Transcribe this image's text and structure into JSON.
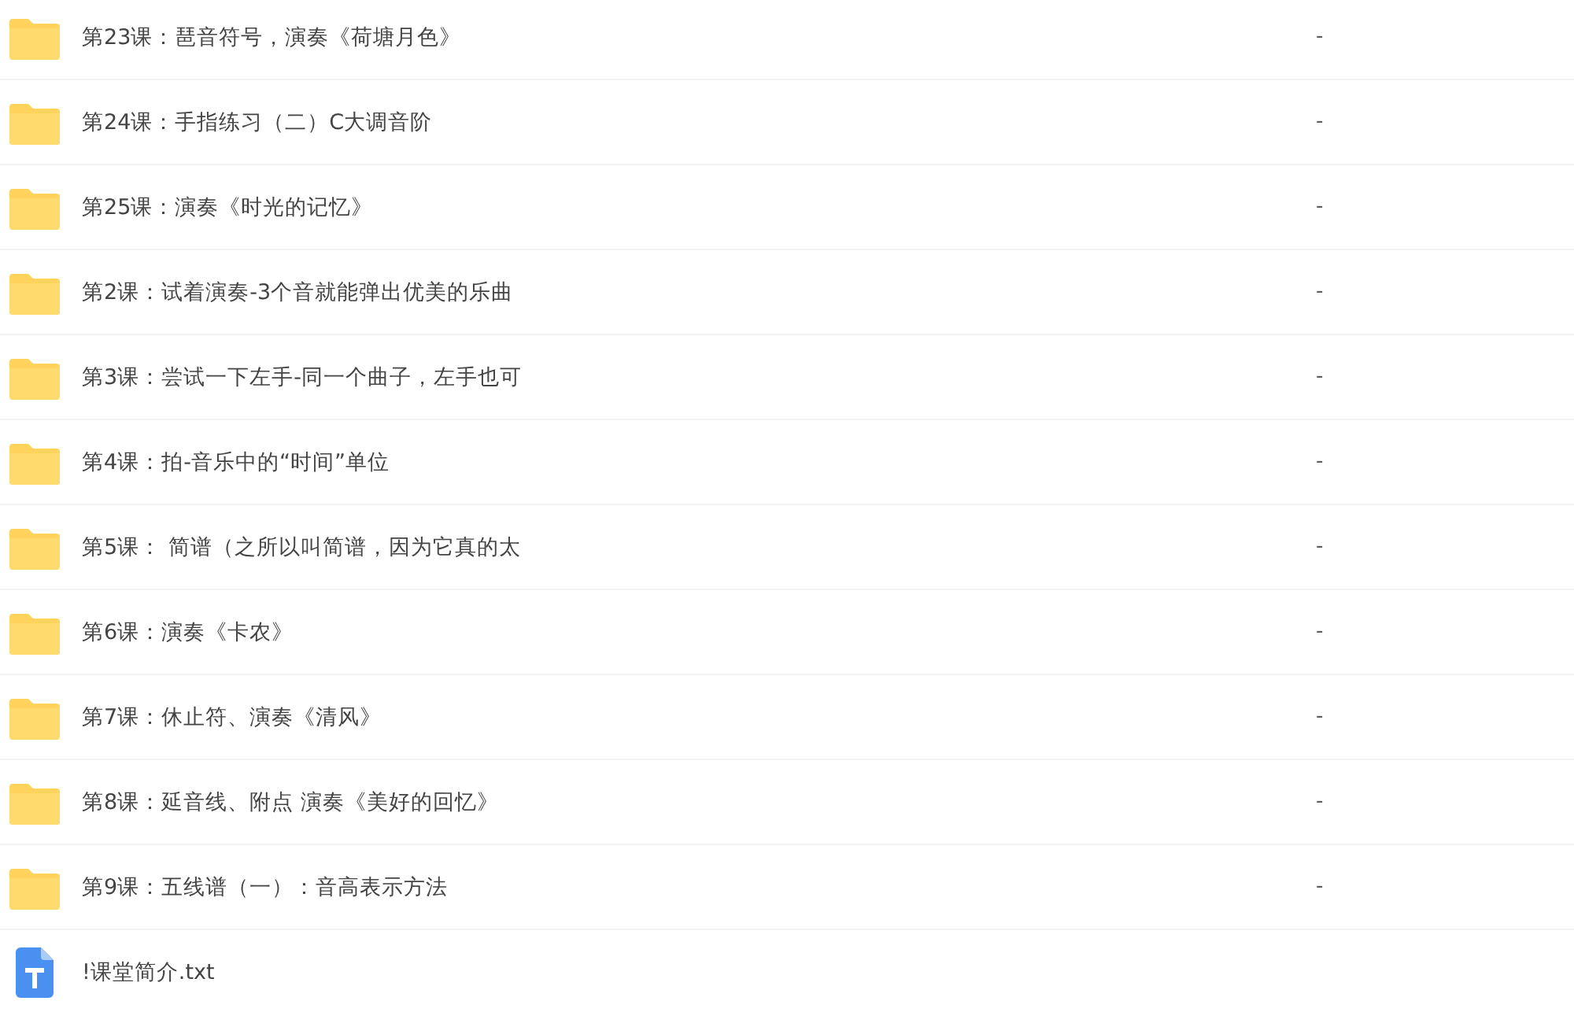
{
  "files": [
    {
      "kind": "folder",
      "name": "第23课：琶音符号，演奏《荷塘月色》",
      "size": "-"
    },
    {
      "kind": "folder",
      "name": "第24课：手指练习（二）C大调音阶",
      "size": "-"
    },
    {
      "kind": "folder",
      "name": "第25课：演奏《时光的记忆》",
      "size": "-"
    },
    {
      "kind": "folder",
      "name": "第2课：试着演奏-3个音就能弹出优美的乐曲",
      "size": "-"
    },
    {
      "kind": "folder",
      "name": "第3课：尝试一下左手-同一个曲子，左手也可",
      "size": "-"
    },
    {
      "kind": "folder",
      "name": "第4课：拍-音乐中的“时间”单位",
      "size": "-"
    },
    {
      "kind": "folder",
      "name": "第5课： 简谱（之所以叫简谱，因为它真的太",
      "size": "-"
    },
    {
      "kind": "folder",
      "name": "第6课：演奏《卡农》",
      "size": "-"
    },
    {
      "kind": "folder",
      "name": "第7课：休止符、演奏《清风》",
      "size": "-"
    },
    {
      "kind": "folder",
      "name": "第8课：延音线、附点 演奏《美好的回忆》",
      "size": "-"
    },
    {
      "kind": "folder",
      "name": "第9课：五线谱（一）：音高表示方法",
      "size": "-"
    },
    {
      "kind": "text",
      "name": "!课堂简介.txt"
    }
  ]
}
